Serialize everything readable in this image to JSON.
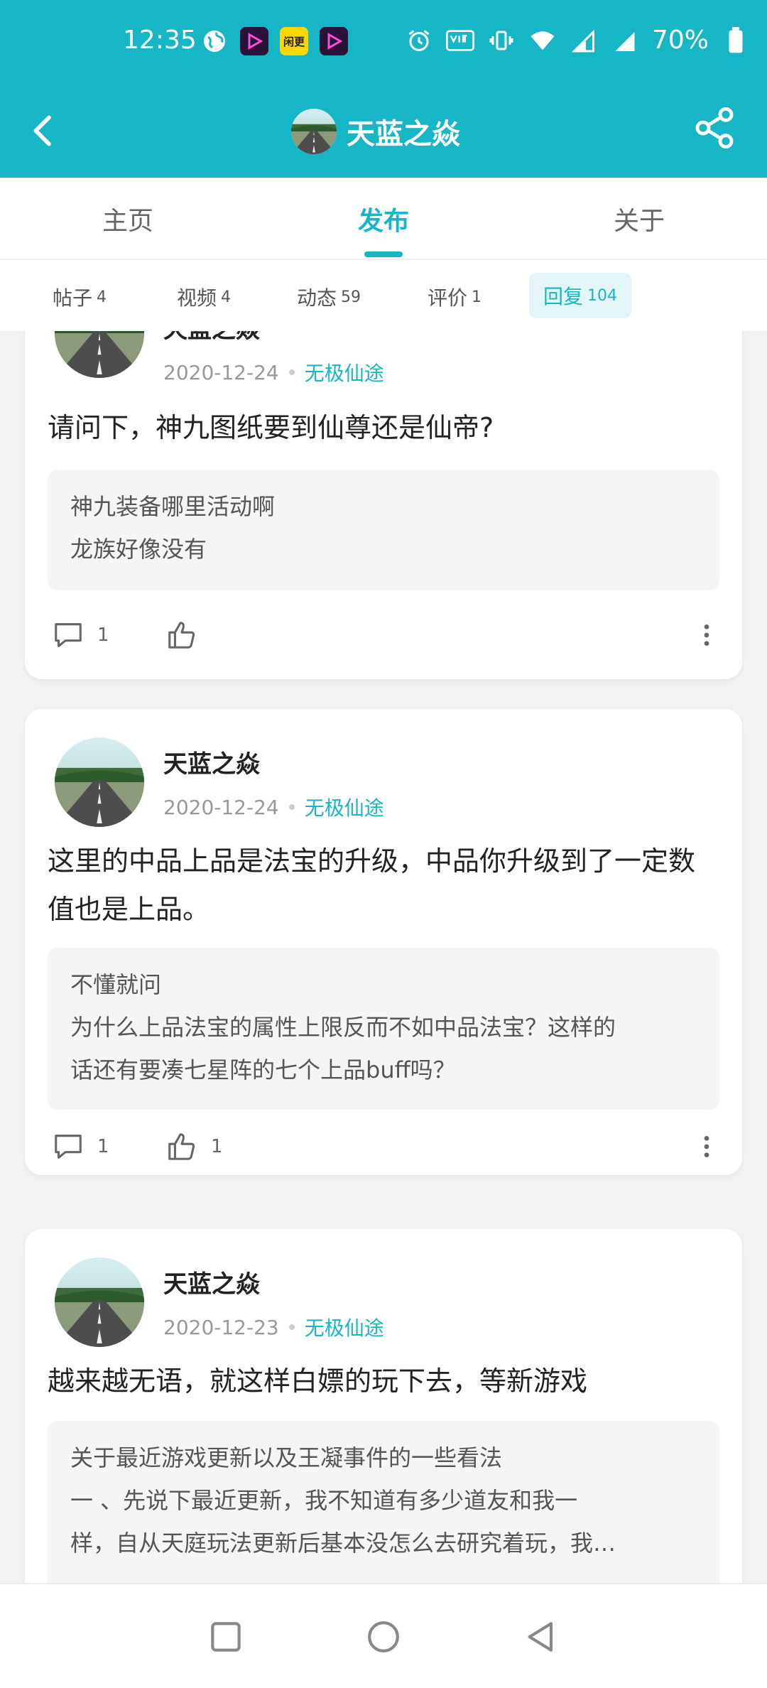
{
  "status_bar": {
    "time": "12:35",
    "left_icons": [
      "globe-icon",
      "app-icon",
      "yellow-app-icon",
      "app-icon"
    ],
    "yellow_app_text": "闲更",
    "battery": "70%"
  },
  "header": {
    "title": "天蓝之焱",
    "back_icon": "chevron-left-icon",
    "share_icon": "share-icon"
  },
  "tabs": [
    {
      "label": "主页",
      "active": false
    },
    {
      "label": "发布",
      "active": true
    },
    {
      "label": "关于",
      "active": false
    }
  ],
  "subtabs": [
    {
      "label": "帖子",
      "count": "4"
    },
    {
      "label": "视频",
      "count": "4"
    },
    {
      "label": "动态",
      "count": "59"
    },
    {
      "label": "评价",
      "count": "1"
    },
    {
      "label": "回复",
      "count": "104",
      "active": true
    }
  ],
  "posts": [
    {
      "username": "天蓝之焱",
      "date": "2020-12-24",
      "game": "无极仙途",
      "content": "请问下，神九图纸要到仙尊还是仙帝?",
      "quote": [
        "神九装备哪里活动啊",
        "龙族好像没有"
      ],
      "comments": "1",
      "likes": ""
    },
    {
      "username": "天蓝之焱",
      "date": "2020-12-24",
      "game": "无极仙途",
      "content": "这里的中品上品是法宝的升级，中品你升级到了一定数值也是上品。",
      "quote": [
        "不懂就问",
        "为什么上品法宝的属性上限反而不如中品法宝？这样的",
        "话还有要凑七星阵的七个上品buff吗？"
      ],
      "comments": "1",
      "likes": "1"
    },
    {
      "username": "天蓝之焱",
      "date": "2020-12-23",
      "game": "无极仙途",
      "content": "越来越无语，就这样白嫖的玩下去，等新游戏",
      "quote": [
        "关于最近游戏更新以及王凝事件的一些看法",
        "一 、先说下最近更新，我不知道有多少道友和我一",
        "样，自从天庭玩法更新后基本没怎么去研究着玩，我…"
      ],
      "comments": "",
      "likes": ""
    }
  ],
  "nav": [
    "square-icon",
    "circle-icon",
    "triangle-back-icon"
  ],
  "colors": {
    "accent": "#17b6c6"
  }
}
